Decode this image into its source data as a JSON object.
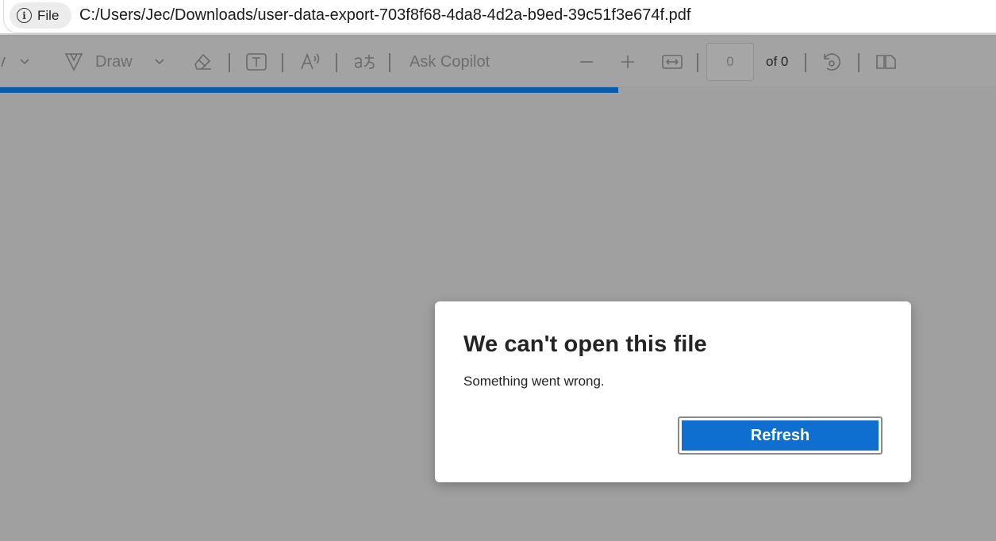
{
  "address_bar": {
    "scheme_label": "File",
    "url": "C:/Users/Jec/Downloads/user-data-export-703f8f68-4da8-4d2a-b9ed-39c51f3e674f.pdf"
  },
  "toolbar": {
    "draw_label": "Draw",
    "ask_copilot_label": "Ask Copilot",
    "page_value": "0",
    "page_total_label": "of 0"
  },
  "progress": {
    "fraction": 0.621,
    "color": "#0b5cad"
  },
  "dialog": {
    "title": "We can't open this file",
    "message": "Something went wrong.",
    "refresh_label": "Refresh",
    "button_color": "#0f6fd0"
  },
  "icons": [
    "info-icon",
    "highlighter-chevron-icon",
    "draw-icon",
    "eraser-icon",
    "text-box-icon",
    "read-aloud-icon",
    "translate-icon",
    "zoom-out-icon",
    "zoom-in-icon",
    "fit-width-icon",
    "rotate-icon",
    "page-view-icon"
  ]
}
